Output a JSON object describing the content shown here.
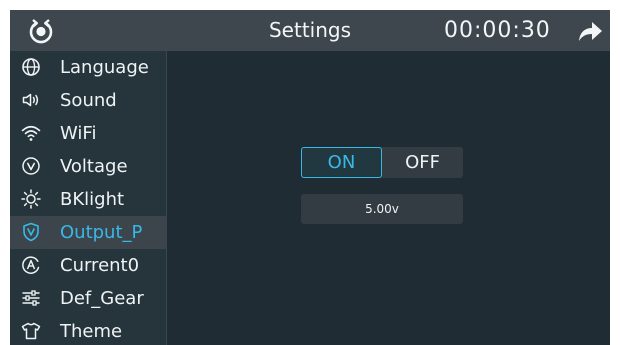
{
  "header": {
    "title": "Settings",
    "timer": "00:00:30",
    "logo_icon": "power-refresh-icon",
    "share_icon": "share-arrow-icon"
  },
  "sidebar": {
    "items": [
      {
        "label": "Language",
        "icon": "globe-icon"
      },
      {
        "label": "Sound",
        "icon": "speaker-icon"
      },
      {
        "label": "WiFi",
        "icon": "wifi-icon"
      },
      {
        "label": "Voltage",
        "icon": "voltage-icon"
      },
      {
        "label": "BKlight",
        "icon": "sun-icon"
      },
      {
        "label": "Output_P",
        "icon": "shield-v-icon",
        "active": true
      },
      {
        "label": "Current0",
        "icon": "current-a-icon"
      },
      {
        "label": "Def_Gear",
        "icon": "sliders-icon"
      },
      {
        "label": "Theme",
        "icon": "shirt-icon"
      }
    ]
  },
  "main": {
    "toggle": {
      "on_label": "ON",
      "off_label": "OFF",
      "selected": "ON"
    },
    "value": "5.00v"
  },
  "colors": {
    "accent": "#39b8e6",
    "background": "#1f2c33",
    "header": "#3d474d",
    "sidebar": "#26343b",
    "active_item": "#3b454b"
  }
}
